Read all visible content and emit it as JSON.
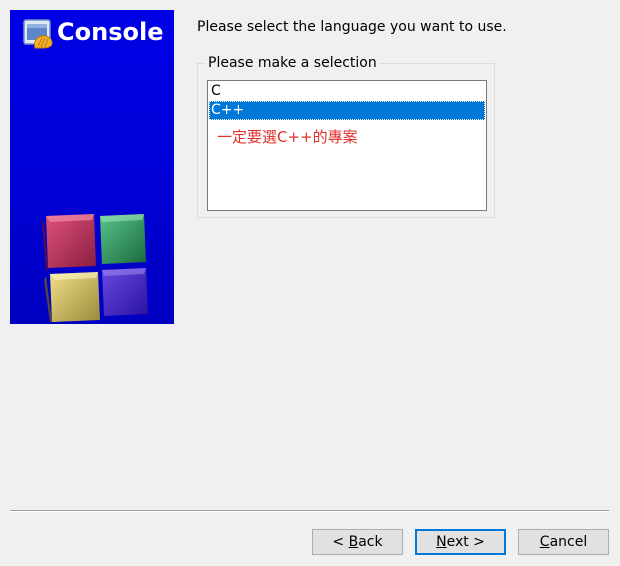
{
  "banner": {
    "title": "Console",
    "icon": "console-app-icon",
    "graphic": "colored-cubes-logo",
    "colors": {
      "background": "#0000d8",
      "title": "#ffffff"
    }
  },
  "prompt": "Please select the language you want to use.",
  "selection_group": {
    "legend": "Please make a selection",
    "items": [
      {
        "label": "C",
        "selected": false
      },
      {
        "label": "C++",
        "selected": true
      }
    ]
  },
  "annotation": {
    "text": "一定要選C++的專案",
    "color": "#e0302a"
  },
  "buttons": {
    "back": {
      "prefix": "< ",
      "mnemonic": "B",
      "rest": "ack"
    },
    "next": {
      "mnemonic": "N",
      "rest": "ext >"
    },
    "cancel": {
      "mnemonic": "C",
      "rest": "ancel"
    }
  },
  "colors": {
    "selection": "#0078d7",
    "default_button_border": "#0078d7",
    "window_background": "#f0f0f0"
  }
}
